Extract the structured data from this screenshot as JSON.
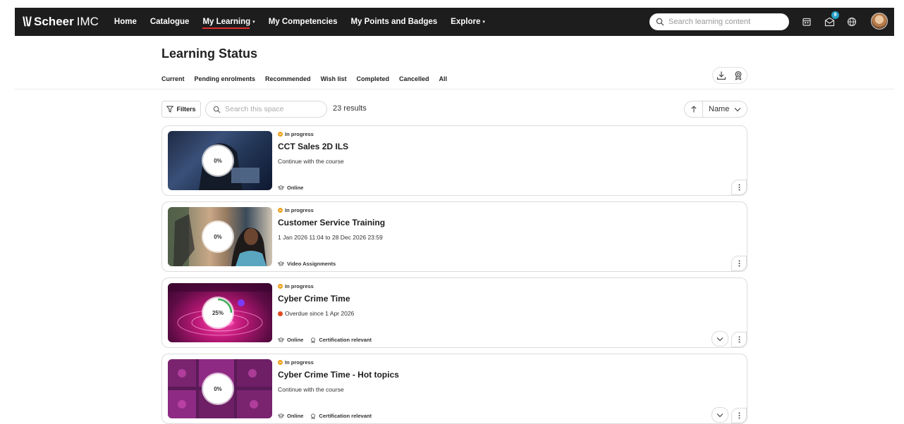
{
  "brand": {
    "mark": "\\\\/",
    "name_bold": "Scheer",
    "name_light": "IMC"
  },
  "nav": {
    "items": [
      {
        "label": "Home",
        "caret": ""
      },
      {
        "label": "Catalogue",
        "caret": ""
      },
      {
        "label": "My Learning",
        "caret": "▾"
      },
      {
        "label": "My Competencies",
        "caret": ""
      },
      {
        "label": "My Points and Badges",
        "caret": ""
      },
      {
        "label": "Explore",
        "caret": "▾"
      }
    ],
    "search_placeholder": "Search learning content",
    "messages_badge": "9"
  },
  "page": {
    "title": "Learning Status",
    "tabs": [
      "Current",
      "Pending enrolments",
      "Recommended",
      "Wish list",
      "Completed",
      "Cancelled",
      "All"
    ]
  },
  "toolbar": {
    "filters_label": "Filters",
    "search_placeholder": "Search this space",
    "results": "23 results",
    "sort_label": "Name"
  },
  "colors": {
    "topbar": "#1d1d1d",
    "active_underline": "#e02b2b",
    "in_progress": "#f2a21a",
    "overdue": "#e04a1f",
    "progress_ring": "#3cae54",
    "badge": "#27a0c9"
  },
  "courses": [
    {
      "status": "In progress",
      "title": "CCT Sales 2D ILS",
      "subtitle": "Continue with the course",
      "progress": "0%",
      "progress_value": 0,
      "overdue": false,
      "meta": [
        "Online"
      ]
    },
    {
      "status": "In progress",
      "title": "Customer Service Training",
      "subtitle": "1 Jan 2026 11:04 to 28 Dec 2026 23:59",
      "progress": "0%",
      "progress_value": 0,
      "overdue": false,
      "meta": [
        "Video Assignments"
      ]
    },
    {
      "status": "In progress",
      "title": "Cyber Crime Time",
      "subtitle": "Overdue since 1 Apr 2026",
      "progress": "25%",
      "progress_value": 25,
      "overdue": true,
      "meta": [
        "Online",
        "Certification relevant"
      ]
    },
    {
      "status": "In progress",
      "title": "Cyber Crime Time - Hot topics",
      "subtitle": "Continue with the course",
      "progress": "0%",
      "progress_value": 0,
      "overdue": false,
      "meta": [
        "Online",
        "Certification relevant"
      ]
    }
  ]
}
